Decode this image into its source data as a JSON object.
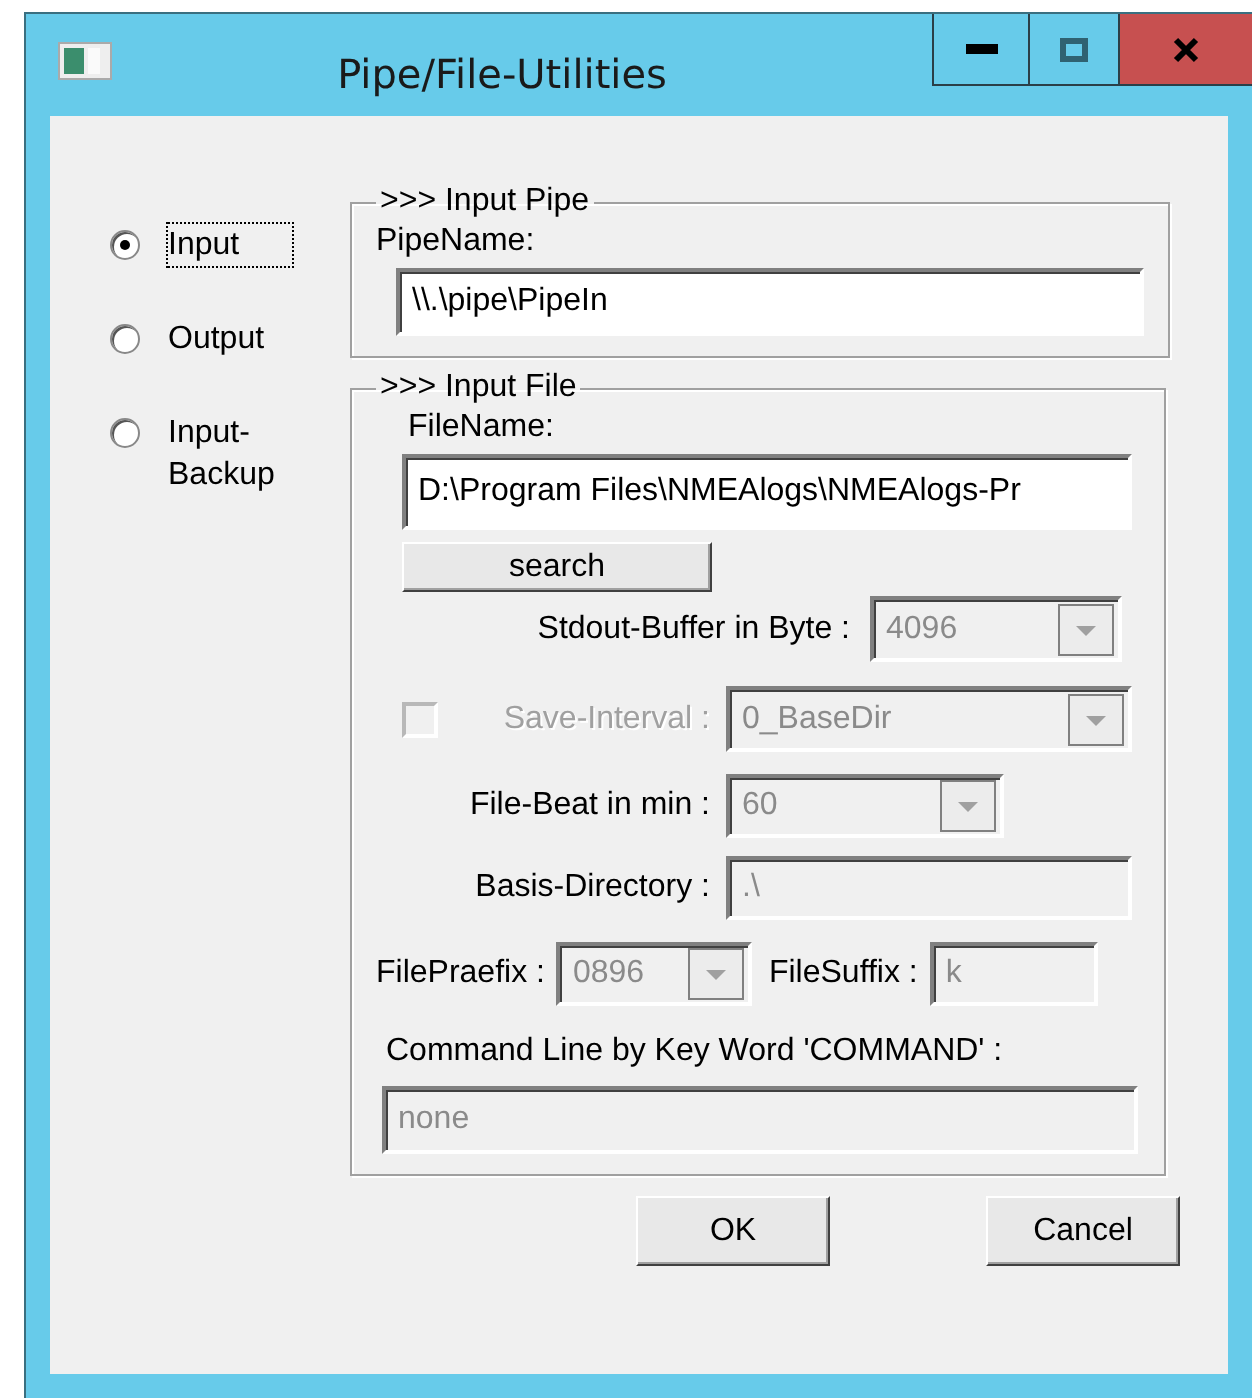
{
  "window": {
    "title": "Pipe/File-Utilities"
  },
  "mode_options": [
    {
      "label": "Input",
      "selected": true,
      "focused": true
    },
    {
      "label": "Output",
      "selected": false,
      "focused": false
    },
    {
      "label": "Input-Backup",
      "selected": false,
      "focused": false
    }
  ],
  "input_pipe": {
    "title": ">>> Input Pipe",
    "label": "PipeName:",
    "value": "\\\\.\\pipe\\PipeIn"
  },
  "input_file": {
    "title": ">>> Input File",
    "filename_label": "FileName:",
    "filename_value": "D:\\Program Files\\NMEAlogs\\NMEAlogs-Pr",
    "search_button": "search",
    "stdout_buffer": {
      "label": "Stdout-Buffer in Byte :",
      "value": "4096",
      "disabled": true
    },
    "save_interval": {
      "label": "Save-Interval :",
      "value": "0_BaseDir",
      "checked": false,
      "disabled": true
    },
    "file_beat": {
      "label": "File-Beat in min :",
      "value": "60",
      "disabled": true
    },
    "basis_directory": {
      "label": "Basis-Directory :",
      "value": ".\\",
      "disabled": true
    },
    "file_praefix": {
      "label": "FilePraefix :",
      "value": "0896",
      "disabled": true
    },
    "file_suffix": {
      "label": "FileSuffix :",
      "value": "k",
      "disabled": true
    },
    "command_line": {
      "label": "Command Line by Key Word 'COMMAND' :",
      "value": "none",
      "disabled": true
    }
  },
  "buttons": [
    {
      "label": "OK"
    },
    {
      "label": "Cancel"
    }
  ]
}
